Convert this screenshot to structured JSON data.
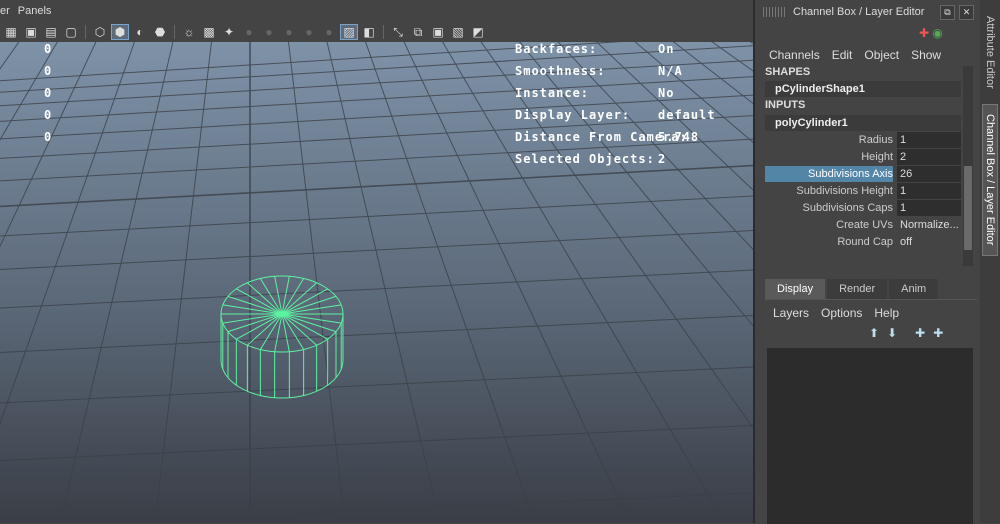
{
  "menubar": {
    "items": [
      "er",
      "Panels"
    ]
  },
  "toolbar": {
    "icons": [
      "grid-icon",
      "camera-icon",
      "film-icon",
      "frame-icon",
      "wireframe-cube-icon",
      "shaded-cube-icon",
      "half-shaded-icon",
      "textured-icon",
      "light-icon",
      "checker-icon",
      "bulb-icon",
      "shadow-icon",
      "ao-icon",
      "aa-icon",
      "dof-icon",
      "motion-icon",
      "xray-icon",
      "isolate-icon",
      "component-icon",
      "snap-icon",
      "resolution-icon",
      "film-gate-icon",
      "safe-icon"
    ]
  },
  "hud": {
    "numbers": [
      "0",
      "0",
      "0",
      "0",
      "0"
    ],
    "labels": [
      "Backfaces:",
      "Smoothness:",
      "Instance:",
      "Display Layer:",
      "Distance From Camera:",
      "Selected Objects:"
    ],
    "values": [
      "On",
      "N/A",
      "No",
      "default",
      "5.748",
      "2"
    ]
  },
  "panel": {
    "title": "Channel Box / Layer Editor",
    "menus": [
      "Channels",
      "Edit",
      "Object",
      "Show"
    ],
    "shapes_header": "SHAPES",
    "shape_node": "pCylinderShape1",
    "inputs_header": "INPUTS",
    "input_node": "polyCylinder1",
    "attributes": [
      {
        "label": "Radius",
        "value": "1"
      },
      {
        "label": "Height",
        "value": "2"
      },
      {
        "label": "Subdivisions Axis",
        "value": "26"
      },
      {
        "label": "Subdivisions Height",
        "value": "1"
      },
      {
        "label": "Subdivisions Caps",
        "value": "1"
      },
      {
        "label": "Create UVs",
        "value": "Normalize..."
      },
      {
        "label": "Round Cap",
        "value": "off"
      }
    ],
    "lower_tabs": [
      "Display",
      "Render",
      "Anim"
    ],
    "layer_menus": [
      "Layers",
      "Options",
      "Help"
    ],
    "side_tabs": [
      "Attribute Editor",
      "Channel Box / Layer Editor"
    ]
  },
  "colors": {
    "wireframe": "#5cf2a0",
    "selection": "#5285a6",
    "sky_top": "#7f93a9",
    "sky_bottom": "#3a3f47"
  }
}
